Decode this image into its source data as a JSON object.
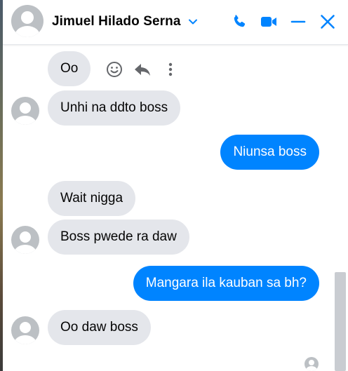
{
  "header": {
    "contact_name": "Jimuel Hilado Serna",
    "icons": [
      "chevron-down-icon",
      "phone-icon",
      "video-camera-icon",
      "minimize-icon",
      "close-icon"
    ]
  },
  "messages": [
    {
      "direction": "incoming",
      "text": "Oo",
      "avatar": false
    },
    {
      "direction": "incoming",
      "text": "Unhi na ddto boss",
      "avatar": true
    },
    {
      "direction": "outgoing",
      "text": "Niunsa boss"
    },
    {
      "direction": "incoming",
      "text": "Wait nigga",
      "avatar": false
    },
    {
      "direction": "incoming",
      "text": "Boss pwede ra daw",
      "avatar": true
    },
    {
      "direction": "outgoing",
      "text": "Mangara ila kauban sa bh?"
    },
    {
      "direction": "incoming",
      "text": "Oo daw boss",
      "avatar": true
    }
  ],
  "message_actions": [
    "smiley-react-icon",
    "reply-icon",
    "more-options-icon"
  ],
  "colors": {
    "accent": "#0084ff",
    "incoming_bubble": "#e4e6eb",
    "outgoing_bubble": "#0084ff"
  }
}
